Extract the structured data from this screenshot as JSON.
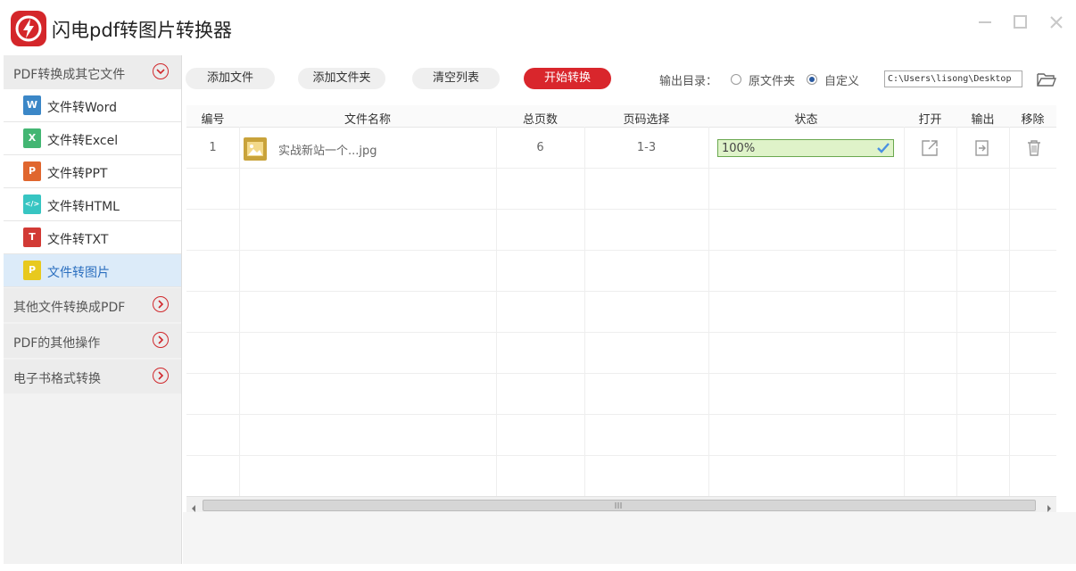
{
  "app": {
    "title": "闪电pdf转图片转换器",
    "brand_color": "#d4262a",
    "window_controls": [
      "minimize-icon",
      "maximize-icon",
      "close-icon"
    ]
  },
  "sidebar": {
    "sections": [
      {
        "label": "PDF转换成其它文件",
        "expanded": true
      },
      {
        "label": "其他文件转换成PDF",
        "expanded": false
      },
      {
        "label": "PDF的其他操作",
        "expanded": false
      },
      {
        "label": "电子书格式转换",
        "expanded": false
      }
    ],
    "items": [
      {
        "label": "文件转Word",
        "icon": "W",
        "icon_color": "#3b87c7",
        "selected": false
      },
      {
        "label": "文件转Excel",
        "icon": "X",
        "icon_color": "#43b673",
        "selected": false
      },
      {
        "label": "文件转PPT",
        "icon": "P",
        "icon_color": "#e0662e",
        "selected": false
      },
      {
        "label": "文件转HTML",
        "icon": "</>",
        "icon_color": "#37c5c2",
        "selected": false
      },
      {
        "label": "文件转TXT",
        "icon": "T",
        "icon_color": "#d23a35",
        "selected": false
      },
      {
        "label": "文件转图片",
        "icon": "P",
        "icon_color": "#e8c91e",
        "selected": true
      }
    ]
  },
  "toolbar": {
    "add_file": "添加文件",
    "add_folder": "添加文件夹",
    "clear_list": "清空列表",
    "start": "开始转换",
    "output_label": "输出目录：",
    "radio_original": "原文件夹",
    "radio_custom": "自定义",
    "selected_output": "自定义",
    "path": "C:\\Users\\lisong\\Desktop"
  },
  "table": {
    "headers": [
      "编号",
      "文件名称",
      "总页数",
      "页码选择",
      "状态",
      "打开",
      "输出",
      "移除"
    ],
    "rows": [
      {
        "index": "1",
        "name": "实战新站一个...jpg",
        "pages": "6",
        "range": "1-3",
        "status": "100%",
        "progress": 1.0
      }
    ]
  }
}
